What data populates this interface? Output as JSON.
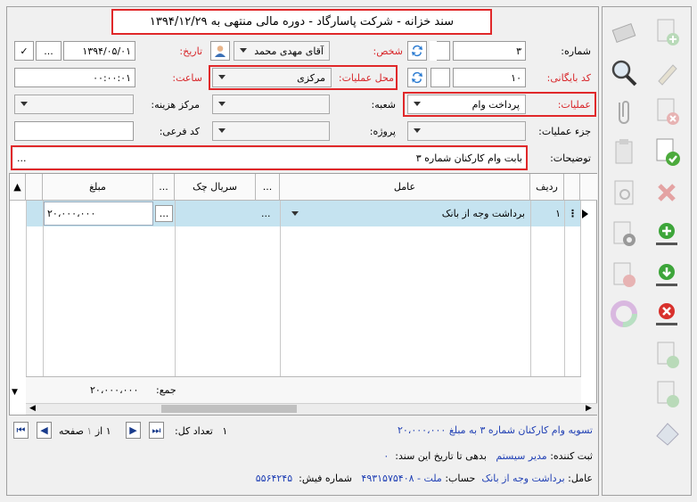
{
  "title": "سند خزانه  -  شرکت پاسارگاد  -  دوره مالی منتهی به ۱۳۹۴/۱۲/۲۹",
  "form": {
    "number_label": "شماره:",
    "number_value": "۳",
    "person_label": "شخص:",
    "person_value": "آقای مهدی محمد",
    "date_label": "تاریخ:",
    "date_value": "۱۳۹۴/۰۵/۰۱",
    "date_more": "...",
    "archive_label": "کد بایگانی:",
    "archive_value": "۱۰",
    "location_label": "محل عملیات:",
    "location_value": "مرکزی",
    "time_label": "ساعت:",
    "time_value": "۰۰:۰۰:۰۱",
    "operation_label": "عملیات:",
    "operation_value": "پرداخت وام",
    "branch_label": "شعبه:",
    "cost_center_label": "مرکز هزینه:",
    "op_part_label": "جزء عملیات:",
    "project_label": "پروژه:",
    "subcode_label": "کد فرعی:",
    "desc_label": "توضیحات:",
    "desc_value": "بابت وام کارکنان شماره ۳",
    "desc_more": "..."
  },
  "grid": {
    "headers": {
      "row": "ردیف",
      "agent": "عامل",
      "serial": "سریال چک",
      "amount": "مبلغ",
      "more": "..."
    },
    "rows": [
      {
        "row": "۱",
        "agent": "برداشت وجه از بانک",
        "amount": "۲۰،۰۰۰،۰۰۰",
        "more": "..."
      }
    ],
    "sum_label": "جمع:",
    "sum_value": "۲۰،۰۰۰،۰۰۰"
  },
  "pager": {
    "count_label": "تعداد کل:",
    "count_value": "۱",
    "page_label": "صفحه",
    "page_value": "۱",
    "of_label": "از",
    "of_value": "۱"
  },
  "footer": {
    "summary": "تسویه وام کارکنان شماره ۳ به مبلغ ۲۰،۰۰۰،۰۰۰",
    "registrar_label": "ثبت کننده:",
    "registrar_value": "مدیر سیستم",
    "debt_label": "بدهی تا تاریخ این سند:",
    "debt_value": "۰",
    "agent_label": "عامل:",
    "agent_value": "برداشت وجه از بانک",
    "account_label": "حساب:",
    "account_value": "ملت - ۴۹۳۱۵۷۵۴۰۸",
    "receipt_label": "شماره فیش:",
    "receipt_value": "۵۵۶۴۲۴۵"
  },
  "colors": {
    "highlight": "#e0282a",
    "accent": "#1f3fb4",
    "selected_row": "#c5e3f0"
  }
}
